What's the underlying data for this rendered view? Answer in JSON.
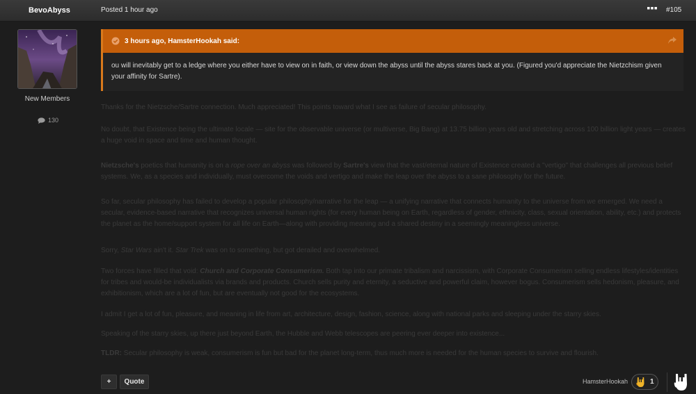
{
  "header": {
    "author": "BevoAbyss",
    "posted": "Posted 1 hour ago",
    "post_number": "#105",
    "more_icon": "ellipsis-icon"
  },
  "sidebar": {
    "rank": "New Members",
    "post_count": "130",
    "post_count_icon": "speech-bubble-icon"
  },
  "quote": {
    "header": "3 hours ago, HamsterHookah said:",
    "text": "ou will inevitably get to a ledge where you either have to view on in faith, or view down the abyss until the abyss stares back at you. (Figured you'd appreciate the Nietzchism given your affinity for Sartre).",
    "accent_color": "#c45e0a"
  },
  "content": {
    "p1": "Thanks for the Nietzsche/Sartre connection. Much appreciated! This points toward what I see as failure of secular philosophy.",
    "p2": "No doubt, that Existence being the ultimate locale — site for the observable universe (or multiverse, Big Bang) at 13.75 billion years old and stretching across 100 billion light years — creates a huge void in space and time and human thought.",
    "p3_b1": "Nietzsche's",
    "p3_t1": " poetics that humanity is on a ",
    "p3_i1": "rope over an abyss",
    "p3_t2": " was followed by ",
    "p3_b2": "Sartre's",
    "p3_t3": " view that the vast/eternal nature of Existence created a \"vertigo\" that challenges all previous belief systems. We, as a species and individually, must overcome the voids and vertigo and make the leap over the abyss to a sane philosophy for the future.",
    "p4": "So far, secular philosophy has failed to develop a popular philosophy/narrative for the leap — a unifying narrative that connects humanity to the universe from we emerged. We need a secular, evidence-based narrative that recognizes universal human rights (for every human being on Earth, regardless of gender, ethnicity, class, sexual orientation, ability, etc.) and protects the planet as the home/support system for all life on Earth—along with providing meaning and a shared destiny in a seemingly meaningless universe.",
    "p5_t1": "Sorry, ",
    "p5_i1": "Star Wars",
    "p5_t2": " ain't it. ",
    "p5_i2": "Star Trek",
    "p5_t3": " was on to something, but got derailed and overwhelmed.",
    "p6_t1": "Two forces have filled that void: ",
    "p6_bi": "Church and Corporate Consumerism.",
    "p6_t2": " Both tap into our primate tribalism and narcissism, with Corporate Consumerism selling endless lifestyles/identities for tribes and would-be individualists via brands and products. Church sells purity and eternity, a seductive and powerful claim, however bogus. Consumerism sells hedonism, pleasure, and exhibitionism, which are a lot of fun, but are eventually not good for the ecosystems.",
    "p7": "I admit I get a lot of fun, pleasure, and meaning in life from art, architecture, design, fashion, science, along with national parks and sleeping under the starry skies.",
    "p8": "Speaking of the starry skies, up there just beyond Earth, the Hubble and Webb telescopes are peering ever deeper into existence...",
    "p9_b": "TLDR:",
    "p9_t": " Secular philosophy is weak, consumerism is fun but bad for the planet long-term, thus much more is needed for the human species to survive and flourish."
  },
  "footer": {
    "plus_label": "+",
    "quote_label": "Quote",
    "reaction_user": "HamsterHookah",
    "reaction_count": "1",
    "reaction_icon": "rock-hand-icon"
  }
}
